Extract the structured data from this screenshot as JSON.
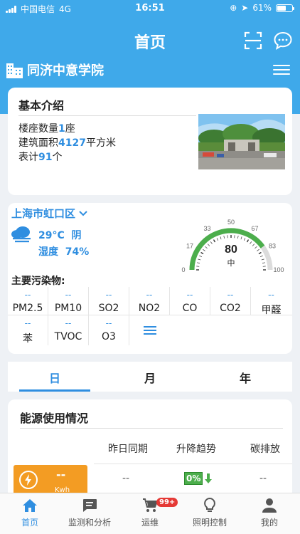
{
  "status_bar": {
    "carrier": "中国电信",
    "network": "4G",
    "time": "16:51",
    "battery": "61%",
    "battery_level": 0.61
  },
  "nav": {
    "title": "首页",
    "scan_icon": "scan-icon",
    "chat_icon": "chat-icon",
    "menu_icon": "menu-icon"
  },
  "school": {
    "name": "同济中意学院",
    "icon": "building-icon"
  },
  "intro": {
    "title": "基本介绍",
    "building_prefix": "楼座数量",
    "building_count": "1",
    "building_unit": "座",
    "area_prefix": "建筑面积",
    "area_value": "4127",
    "area_unit": "平方米",
    "meter_prefix": "表计",
    "meter_count": "91",
    "meter_unit": "个"
  },
  "weather": {
    "location": "上海市虹口区",
    "temp": "29°C",
    "condition": "阴",
    "humidity_label": "湿度",
    "humidity": "74%",
    "aqi": {
      "value": "80",
      "level": "中",
      "ticks": [
        "0",
        "17",
        "33",
        "50",
        "67",
        "83",
        "100"
      ],
      "fraction": 0.8
    }
  },
  "pollutants": {
    "title": "主要污染物:",
    "rows": [
      [
        {
          "value": "--",
          "name": "PM2.5"
        },
        {
          "value": "--",
          "name": "PM10"
        },
        {
          "value": "--",
          "name": "SO2"
        },
        {
          "value": "--",
          "name": "NO2"
        },
        {
          "value": "--",
          "name": "CO"
        },
        {
          "value": "--",
          "name": "CO2"
        },
        {
          "value": "--",
          "name": "甲醛"
        }
      ],
      [
        {
          "value": "--",
          "name": "苯"
        },
        {
          "value": "--",
          "name": "TVOC"
        },
        {
          "value": "--",
          "name": "O3"
        }
      ]
    ]
  },
  "period_tabs": [
    "日",
    "月",
    "年"
  ],
  "energy": {
    "title": "能源使用情况",
    "headers": [
      "昨日同期",
      "升降趋势",
      "碳排放"
    ],
    "kwh_value": "--",
    "kwh_unit": "Kwh",
    "same_period": "--",
    "trend_pct": "0%",
    "carbon": "--"
  },
  "tabbar": [
    {
      "label": "首页",
      "icon": "home-icon"
    },
    {
      "label": "监测和分析",
      "icon": "message-icon"
    },
    {
      "label": "运维",
      "icon": "cart-icon",
      "badge": "99+"
    },
    {
      "label": "照明控制",
      "icon": "bulb-icon"
    },
    {
      "label": "我的",
      "icon": "person-icon"
    }
  ],
  "colors": {
    "primary": "#3fa9ea",
    "accent_blue": "#2f8ee0",
    "orange": "#f39c23",
    "green": "#4cae4c"
  }
}
